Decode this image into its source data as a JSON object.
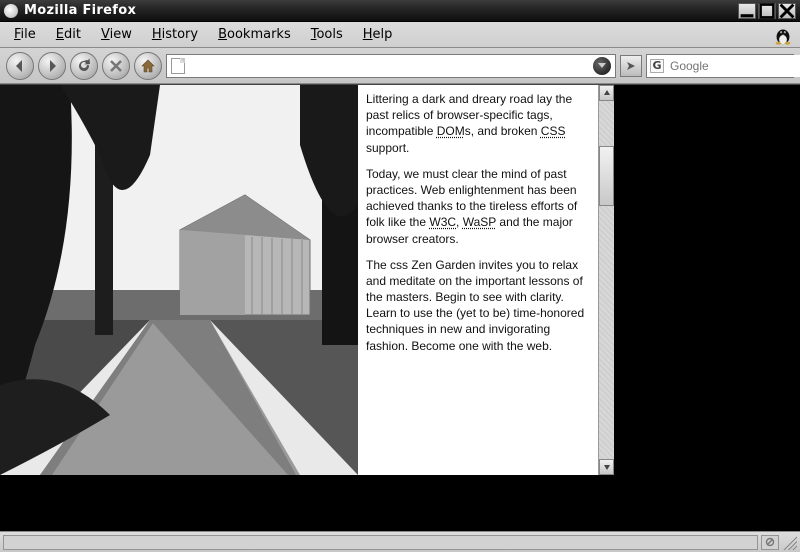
{
  "title": "Mozilla Firefox",
  "menu": [
    "File",
    "Edit",
    "View",
    "History",
    "Bookmarks",
    "Tools",
    "Help"
  ],
  "toolbar": {
    "url_value": "",
    "search_placeholder": "Google",
    "search_engine_glyph": "G"
  },
  "page": {
    "para1_a": "Littering a dark and dreary road lay the past relics of browser-specific tags, incompatible ",
    "para1_dom": "DOM",
    "para1_b": "s, and broken ",
    "para1_css": "CSS",
    "para1_c": " support.",
    "para2_a": "Today, we must clear the mind of past practices. Web enlightenment has been achieved thanks to the tireless efforts of folk like the ",
    "para2_w3c": "W3C",
    "para2_b": ", ",
    "para2_wasp": "WaSP",
    "para2_c": " and the major browser creators.",
    "para3": "The css Zen Garden invites you to relax and meditate on the important lessons of the masters. Begin to see with clarity. Learn to use the (yet to be) time-honored techniques in new and invigorating fashion. Become one with the web."
  }
}
